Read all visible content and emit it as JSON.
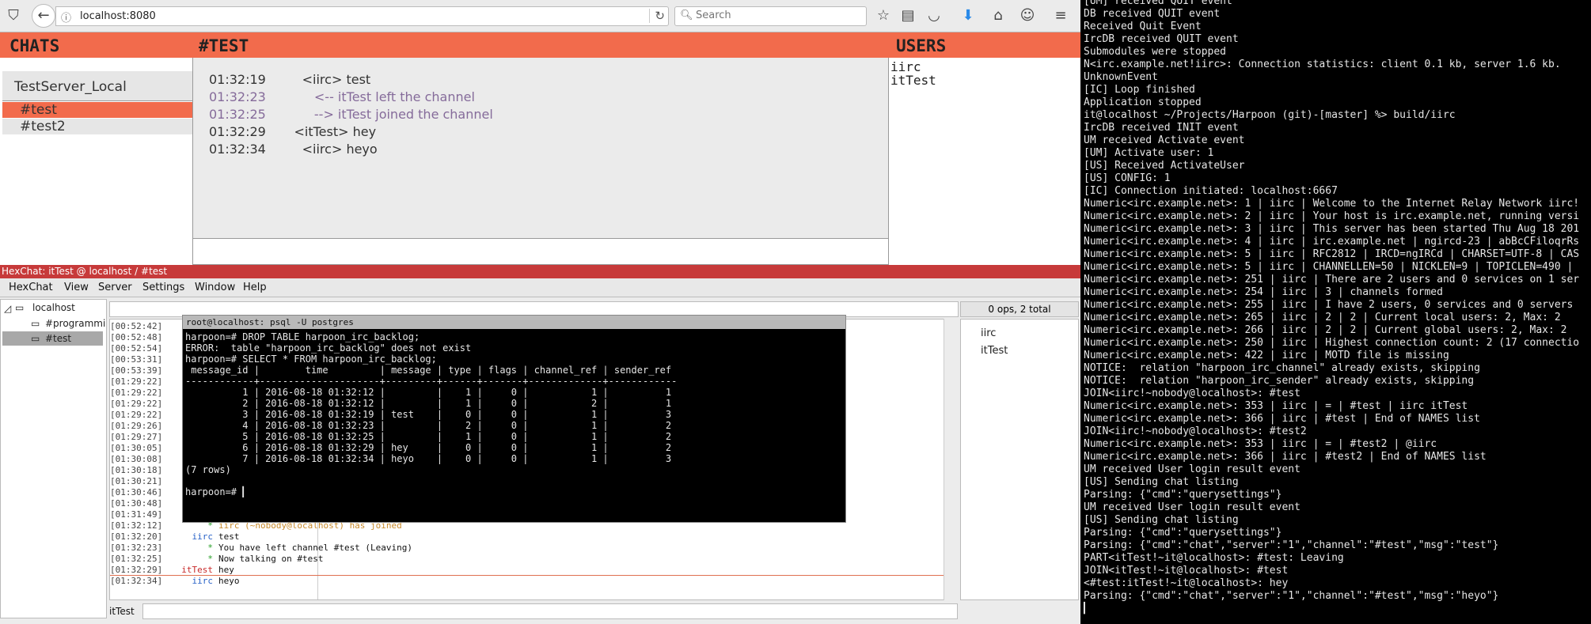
{
  "browser": {
    "url": "localhost:8080",
    "search_placeholder": "Search"
  },
  "app": {
    "chats_header": "CHATS",
    "channel_header": "#TEST",
    "users_header": "USERS",
    "server_name": "TestServer_Local",
    "channels": [
      "#test",
      "#test2"
    ],
    "messages": [
      {
        "time": "01:32:19",
        "text": "       <iirc> test"
      },
      {
        "time": "01:32:23",
        "text": "          <-- itTest left the channel"
      },
      {
        "time": "01:32:25",
        "text": "          --> itTest joined the channel"
      },
      {
        "time": "01:32:29",
        "text": "     <itTest> hey"
      },
      {
        "time": "01:32:34",
        "text": "       <iirc> heyo"
      }
    ],
    "users": [
      "iirc",
      "itTest"
    ]
  },
  "hexchat": {
    "title": "HexChat: itTest @ localhost / #test",
    "menu": [
      "HexChat",
      "View",
      "Server",
      "Settings",
      "Window",
      "Help"
    ],
    "tree": {
      "server": "localhost",
      "chan1": "#programmi",
      "chan2": "#test"
    },
    "ops": "0 ops, 2 total",
    "lines": [
      {
        "ts": "[00:52:42]",
        "nick": "",
        "text": ""
      },
      {
        "ts": "[00:52:48]",
        "nick": "",
        "text": ""
      },
      {
        "ts": "[00:52:54]",
        "nick": "",
        "text": ""
      },
      {
        "ts": "[00:53:31]",
        "nick": "",
        "text": ""
      },
      {
        "ts": "[00:53:39]",
        "nick": "i",
        "text": ""
      },
      {
        "ts": "[01:29:22]",
        "nick": "",
        "text": ""
      },
      {
        "ts": "[01:29:22]",
        "nick": "",
        "text": ""
      },
      {
        "ts": "[01:29:22]",
        "nick": "",
        "text": ""
      },
      {
        "ts": "[01:29:22]",
        "nick": "",
        "text": ""
      },
      {
        "ts": "[01:29:26]",
        "nick": "i",
        "text": ""
      },
      {
        "ts": "[01:29:27]",
        "nick": "",
        "text": ""
      },
      {
        "ts": "[01:30:05]",
        "nick": "",
        "text": ""
      },
      {
        "ts": "[01:30:08]",
        "nick": "i",
        "text": ""
      },
      {
        "ts": "[01:30:18]",
        "nick": "",
        "text": ""
      },
      {
        "ts": "[01:30:21]",
        "nick": "i",
        "text": ""
      },
      {
        "ts": "[01:30:46]",
        "nick": "",
        "text": ""
      },
      {
        "ts": "[01:30:48]",
        "nick": "",
        "text": ""
      },
      {
        "ts": "[01:31:49]",
        "nick": "",
        "text": ""
      },
      {
        "ts": "[01:32:12]",
        "nick": "*",
        "text": "iirc (~nobody@localhost) has joined"
      },
      {
        "ts": "[01:32:20]",
        "nick": "iirc",
        "text": "test"
      },
      {
        "ts": "[01:32:23]",
        "nick": "*",
        "text": "You have left channel #test (Leaving)"
      },
      {
        "ts": "[01:32:25]",
        "nick": "*",
        "text": "Now talking on #test"
      },
      {
        "ts": "[01:32:29]",
        "nick": "itTest",
        "text": "hey"
      },
      {
        "ts": "[01:32:34]",
        "nick": "iirc",
        "text": "heyo"
      }
    ],
    "userlist": [
      "iirc",
      "itTest"
    ],
    "nick": "itTest"
  },
  "psql": {
    "title": "root@localhost: psql -U postgres",
    "lines": [
      "harpoon=# DROP TABLE harpoon_irc_backlog;",
      "ERROR:  table \"harpoon_irc_backlog\" does not exist",
      "harpoon=# SELECT * FROM harpoon_irc_backlog;",
      " message_id |        time         | message | type | flags | channel_ref | sender_ref",
      "------------+---------------------+---------+------+-------+-------------+------------",
      "          1 | 2016-08-18 01:32:12 |         |    1 |     0 |           1 |          1",
      "          2 | 2016-08-18 01:32:12 |         |    1 |     0 |           2 |          1",
      "          3 | 2016-08-18 01:32:19 | test    |    0 |     0 |           1 |          3",
      "          4 | 2016-08-18 01:32:23 |         |    2 |     0 |           1 |          2",
      "          5 | 2016-08-18 01:32:25 |         |    1 |     0 |           1 |          2",
      "          6 | 2016-08-18 01:32:29 | hey     |    0 |     0 |           1 |          2",
      "          7 | 2016-08-18 01:32:34 | heyo    |    0 |     0 |           1 |          3",
      "(7 rows)",
      "",
      "harpoon=# ▎"
    ]
  },
  "terminal": {
    "lines": [
      "[UM] received QUIT event",
      "DB received QUIT event",
      "Received Quit Event",
      "IrcDB received QUIT event",
      "Submodules were stopped",
      "N<irc.example.net!iirc>: Connection statistics: client 0.1 kb, server 1.6 kb.",
      "UnknownEvent",
      "[IC] Loop finished",
      "Application stopped",
      "it@localhost ~/Projects/Harpoon (git)-[master] %> build/iirc",
      "IrcDB received INIT event",
      "UM received Activate event",
      "[UM] Activate user: 1",
      "[US] Received ActivateUser",
      "[US] CONFIG: 1",
      "[IC] Connection initiated: localhost:6667",
      "Numeric<irc.example.net>: 1 | iirc | Welcome to the Internet Relay Network iirc!",
      "Numeric<irc.example.net>: 2 | iirc | Your host is irc.example.net, running versi",
      "Numeric<irc.example.net>: 3 | iirc | This server has been started Thu Aug 18 201",
      "Numeric<irc.example.net>: 4 | iirc | irc.example.net | ngircd-23 | abBcCFiloqrRs",
      "Numeric<irc.example.net>: 5 | iirc | RFC2812 | IRCD=ngIRCd | CHARSET=UTF-8 | CAS",
      "Numeric<irc.example.net>: 5 | iirc | CHANNELLEN=50 | NICKLEN=9 | TOPICLEN=490 |",
      "Numeric<irc.example.net>: 251 | iirc | There are 2 users and 0 services on 1 ser",
      "Numeric<irc.example.net>: 254 | iirc | 3 | channels formed",
      "Numeric<irc.example.net>: 255 | iirc | I have 2 users, 0 services and 0 servers",
      "Numeric<irc.example.net>: 265 | iirc | 2 | 2 | Current local users: 2, Max: 2",
      "Numeric<irc.example.net>: 266 | iirc | 2 | 2 | Current global users: 2, Max: 2",
      "Numeric<irc.example.net>: 250 | iirc | Highest connection count: 2 (17 connectio",
      "Numeric<irc.example.net>: 422 | iirc | MOTD file is missing",
      "NOTICE:  relation \"harpoon_irc_channel\" already exists, skipping",
      "NOTICE:  relation \"harpoon_irc_sender\" already exists, skipping",
      "JOIN<iirc!~nobody@localhost>: #test",
      "Numeric<irc.example.net>: 353 | iirc | = | #test | iirc itTest",
      "Numeric<irc.example.net>: 366 | iirc | #test | End of NAMES list",
      "JOIN<iirc!~nobody@localhost>: #test2",
      "Numeric<irc.example.net>: 353 | iirc | = | #test2 | @iirc",
      "Numeric<irc.example.net>: 366 | iirc | #test2 | End of NAMES list",
      "UM received User login result event",
      "[US] Sending chat listing",
      "Parsing: {\"cmd\":\"querysettings\"}",
      "UM received User login result event",
      "[US] Sending chat listing",
      "Parsing: {\"cmd\":\"querysettings\"}",
      "Parsing: {\"cmd\":\"chat\",\"server\":\"1\",\"channel\":\"#test\",\"msg\":\"test\"}",
      "PART<itTest!~it@localhost>: #test: Leaving",
      "JOIN<itTest!~it@localhost>: #test",
      "<#test:itTest!~it@localhost>: hey",
      "Parsing: {\"cmd\":\"chat\",\"server\":\"1\",\"channel\":\"#test\",\"msg\":\"heyo\"}",
      "▎"
    ]
  }
}
